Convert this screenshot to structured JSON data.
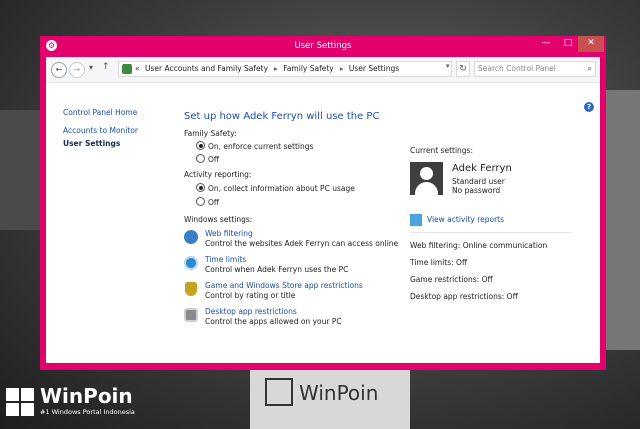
{
  "window": {
    "title": "User Settings"
  },
  "address": {
    "prefix": "«",
    "crumbs": [
      "User Accounts and Family Safety",
      "Family Safety",
      "User Settings"
    ],
    "search_placeholder": "Search Control Panel"
  },
  "sidebar": {
    "items": [
      {
        "label": "Control Panel Home"
      },
      {
        "label": "Accounts to Monitor"
      },
      {
        "label": "User Settings"
      }
    ]
  },
  "main": {
    "heading": "Set up how Adek Ferryn will use the PC",
    "family_safety": {
      "label": "Family Safety:",
      "options": [
        "On, enforce current settings",
        "Off"
      ],
      "selected": "On, enforce current settings"
    },
    "activity": {
      "label": "Activity reporting:",
      "options": [
        "On, collect information about PC usage",
        "Off"
      ],
      "selected": "On, collect information about PC usage"
    },
    "windows_settings_label": "Windows settings:",
    "windows_settings": [
      {
        "link": "Web filtering",
        "desc": "Control the websites Adek Ferryn can access online",
        "icon": "globe-icon",
        "color": "#3a7fc4"
      },
      {
        "link": "Time limits",
        "desc": "Control when Adek Ferryn uses the PC",
        "icon": "clock-icon",
        "color": "#2a8bd0"
      },
      {
        "link": "Game and Windows Store app restrictions",
        "desc": "Control by rating or title",
        "icon": "trophy-icon",
        "color": "#c8a21e"
      },
      {
        "link": "Desktop app restrictions",
        "desc": "Control the apps allowed on your PC",
        "icon": "desktop-app-icon",
        "color": "#7a7a7a"
      }
    ]
  },
  "current": {
    "label": "Current settings:",
    "name": "Adek Ferryn",
    "role": "Standard user",
    "password": "No password",
    "view_reports": "View activity reports",
    "stats": [
      "Web filtering: Online communication",
      "Time limits: Off",
      "Game restrictions: Off",
      "Desktop app restrictions: Off"
    ]
  },
  "watermark": {
    "center_text": "WinPoin",
    "brand_name": "WinPoin",
    "brand_tag": "#1 Windows Portal Indonesia"
  },
  "colors": {
    "window_frame": "#e3006d",
    "link": "#1a4ea5",
    "heading": "#1e4fa6"
  }
}
